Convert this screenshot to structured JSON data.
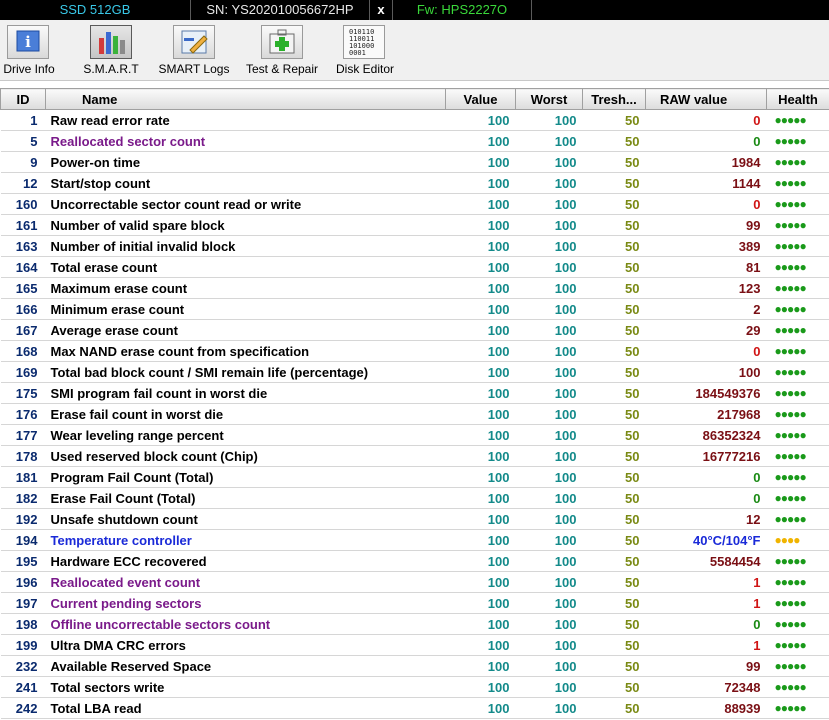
{
  "header": {
    "model": "SSD 512GB",
    "serial": "SN: YS202010056672HP",
    "close": "x",
    "firmware": "Fw: HPS2227O"
  },
  "toolbar": {
    "drive_info": "Drive Info",
    "smart": "S.M.A.R.T",
    "smart_logs": "SMART Logs",
    "test_repair": "Test & Repair",
    "disk_editor": "Disk Editor",
    "disk_editor_icon_text": "010110\n110011\n101000\n0001"
  },
  "columns": {
    "id": "ID",
    "name": "Name",
    "value": "Value",
    "worst": "Worst",
    "thresh": "Tresh...",
    "raw": "RAW value",
    "health": "Health"
  },
  "rows": [
    {
      "id": "1",
      "name": "Raw read error rate",
      "value": "100",
      "worst": "100",
      "thresh": "50",
      "raw": "0",
      "raw_style": "red",
      "name_style": "normal",
      "health": "●●●●●",
      "health_color": "#1a9a1a"
    },
    {
      "id": "5",
      "name": "Reallocated sector count",
      "value": "100",
      "worst": "100",
      "thresh": "50",
      "raw": "0",
      "raw_style": "green",
      "name_style": "purple",
      "health": "●●●●●",
      "health_color": "#1a9a1a"
    },
    {
      "id": "9",
      "name": "Power-on time",
      "value": "100",
      "worst": "100",
      "thresh": "50",
      "raw": "1984",
      "raw_style": "dark",
      "name_style": "normal",
      "health": "●●●●●",
      "health_color": "#1a9a1a"
    },
    {
      "id": "12",
      "name": "Start/stop count",
      "value": "100",
      "worst": "100",
      "thresh": "50",
      "raw": "1144",
      "raw_style": "dark",
      "name_style": "normal",
      "health": "●●●●●",
      "health_color": "#1a9a1a"
    },
    {
      "id": "160",
      "name": "Uncorrectable sector count read or write",
      "value": "100",
      "worst": "100",
      "thresh": "50",
      "raw": "0",
      "raw_style": "red",
      "name_style": "normal",
      "health": "●●●●●",
      "health_color": "#1a9a1a"
    },
    {
      "id": "161",
      "name": "Number of valid spare block",
      "value": "100",
      "worst": "100",
      "thresh": "50",
      "raw": "99",
      "raw_style": "dark",
      "name_style": "normal",
      "health": "●●●●●",
      "health_color": "#1a9a1a"
    },
    {
      "id": "163",
      "name": "Number of initial invalid block",
      "value": "100",
      "worst": "100",
      "thresh": "50",
      "raw": "389",
      "raw_style": "dark",
      "name_style": "normal",
      "health": "●●●●●",
      "health_color": "#1a9a1a"
    },
    {
      "id": "164",
      "name": "Total erase count",
      "value": "100",
      "worst": "100",
      "thresh": "50",
      "raw": "81",
      "raw_style": "dark",
      "name_style": "normal",
      "health": "●●●●●",
      "health_color": "#1a9a1a"
    },
    {
      "id": "165",
      "name": "Maximum erase count",
      "value": "100",
      "worst": "100",
      "thresh": "50",
      "raw": "123",
      "raw_style": "dark",
      "name_style": "normal",
      "health": "●●●●●",
      "health_color": "#1a9a1a"
    },
    {
      "id": "166",
      "name": "Minimum erase count",
      "value": "100",
      "worst": "100",
      "thresh": "50",
      "raw": "2",
      "raw_style": "dark",
      "name_style": "normal",
      "health": "●●●●●",
      "health_color": "#1a9a1a"
    },
    {
      "id": "167",
      "name": "Average erase count",
      "value": "100",
      "worst": "100",
      "thresh": "50",
      "raw": "29",
      "raw_style": "dark",
      "name_style": "normal",
      "health": "●●●●●",
      "health_color": "#1a9a1a"
    },
    {
      "id": "168",
      "name": "Max NAND erase count from specification",
      "value": "100",
      "worst": "100",
      "thresh": "50",
      "raw": "0",
      "raw_style": "red",
      "name_style": "normal",
      "health": "●●●●●",
      "health_color": "#1a9a1a"
    },
    {
      "id": "169",
      "name": "Total bad block count / SMI remain life (percentage)",
      "value": "100",
      "worst": "100",
      "thresh": "50",
      "raw": "100",
      "raw_style": "dark",
      "name_style": "normal",
      "health": "●●●●●",
      "health_color": "#1a9a1a"
    },
    {
      "id": "175",
      "name": "SMI program fail count in worst die",
      "value": "100",
      "worst": "100",
      "thresh": "50",
      "raw": "184549376",
      "raw_style": "dark",
      "name_style": "normal",
      "health": "●●●●●",
      "health_color": "#1a9a1a"
    },
    {
      "id": "176",
      "name": "Erase fail count in worst die",
      "value": "100",
      "worst": "100",
      "thresh": "50",
      "raw": "217968",
      "raw_style": "dark",
      "name_style": "normal",
      "health": "●●●●●",
      "health_color": "#1a9a1a"
    },
    {
      "id": "177",
      "name": "Wear leveling range percent",
      "value": "100",
      "worst": "100",
      "thresh": "50",
      "raw": "86352324",
      "raw_style": "dark",
      "name_style": "normal",
      "health": "●●●●●",
      "health_color": "#1a9a1a"
    },
    {
      "id": "178",
      "name": "Used reserved block count (Chip)",
      "value": "100",
      "worst": "100",
      "thresh": "50",
      "raw": "16777216",
      "raw_style": "dark",
      "name_style": "normal",
      "health": "●●●●●",
      "health_color": "#1a9a1a"
    },
    {
      "id": "181",
      "name": "Program Fail Count (Total)",
      "value": "100",
      "worst": "100",
      "thresh": "50",
      "raw": "0",
      "raw_style": "green",
      "name_style": "normal",
      "health": "●●●●●",
      "health_color": "#1a9a1a"
    },
    {
      "id": "182",
      "name": "Erase Fail Count (Total)",
      "value": "100",
      "worst": "100",
      "thresh": "50",
      "raw": "0",
      "raw_style": "green",
      "name_style": "normal",
      "health": "●●●●●",
      "health_color": "#1a9a1a"
    },
    {
      "id": "192",
      "name": "Unsafe shutdown count",
      "value": "100",
      "worst": "100",
      "thresh": "50",
      "raw": "12",
      "raw_style": "dark",
      "name_style": "normal",
      "health": "●●●●●",
      "health_color": "#1a9a1a"
    },
    {
      "id": "194",
      "name": "Temperature controller",
      "value": "100",
      "worst": "100",
      "thresh": "50",
      "raw": "40°C/104°F",
      "raw_style": "blue",
      "name_style": "blue",
      "health": "●●●●",
      "health_color": "#f0b400"
    },
    {
      "id": "195",
      "name": "Hardware ECC recovered",
      "value": "100",
      "worst": "100",
      "thresh": "50",
      "raw": "5584454",
      "raw_style": "dark",
      "name_style": "normal",
      "health": "●●●●●",
      "health_color": "#1a9a1a"
    },
    {
      "id": "196",
      "name": "Reallocated event count",
      "value": "100",
      "worst": "100",
      "thresh": "50",
      "raw": "1",
      "raw_style": "red",
      "name_style": "purple",
      "health": "●●●●●",
      "health_color": "#1a9a1a"
    },
    {
      "id": "197",
      "name": "Current pending sectors",
      "value": "100",
      "worst": "100",
      "thresh": "50",
      "raw": "1",
      "raw_style": "red",
      "name_style": "purple",
      "health": "●●●●●",
      "health_color": "#1a9a1a"
    },
    {
      "id": "198",
      "name": "Offline uncorrectable sectors count",
      "value": "100",
      "worst": "100",
      "thresh": "50",
      "raw": "0",
      "raw_style": "green",
      "name_style": "purple",
      "health": "●●●●●",
      "health_color": "#1a9a1a"
    },
    {
      "id": "199",
      "name": "Ultra DMA CRC errors",
      "value": "100",
      "worst": "100",
      "thresh": "50",
      "raw": "1",
      "raw_style": "red",
      "name_style": "normal",
      "health": "●●●●●",
      "health_color": "#1a9a1a"
    },
    {
      "id": "232",
      "name": "Available Reserved Space",
      "value": "100",
      "worst": "100",
      "thresh": "50",
      "raw": "99",
      "raw_style": "dark",
      "name_style": "normal",
      "health": "●●●●●",
      "health_color": "#1a9a1a"
    },
    {
      "id": "241",
      "name": "Total sectors write",
      "value": "100",
      "worst": "100",
      "thresh": "50",
      "raw": "72348",
      "raw_style": "dark",
      "name_style": "normal",
      "health": "●●●●●",
      "health_color": "#1a9a1a"
    },
    {
      "id": "242",
      "name": "Total LBA read",
      "value": "100",
      "worst": "100",
      "thresh": "50",
      "raw": "88939",
      "raw_style": "dark",
      "name_style": "normal",
      "health": "●●●●●",
      "health_color": "#1a9a1a"
    }
  ],
  "colors": {
    "model": "#39c8e8",
    "serial": "#e8e8e8",
    "firmware": "#3ad83a",
    "id": "#0a2a6e",
    "value": "#138a8a",
    "thresh": "#7a8a14",
    "raw_dark": "#7a0f14"
  }
}
